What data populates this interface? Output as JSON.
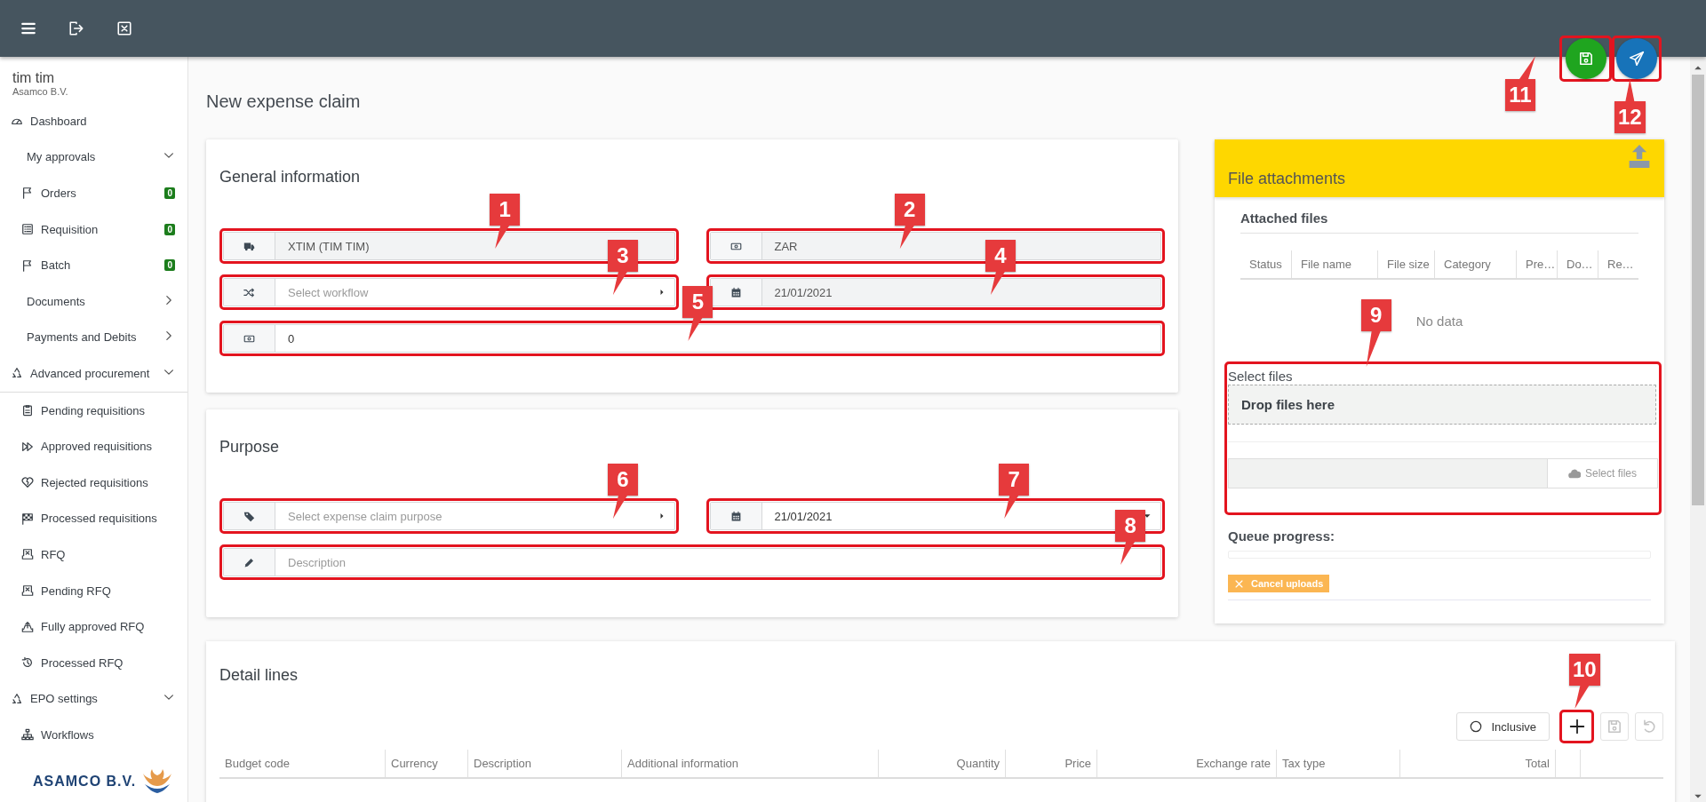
{
  "user": {
    "name": "tim tim",
    "company": "Asamco B.V."
  },
  "sidebar": {
    "items": [
      {
        "label": "Dashboard"
      },
      {
        "label": "My approvals",
        "expanded": true,
        "children": [
          {
            "label": "Orders",
            "badge": "0"
          },
          {
            "label": "Requisition",
            "badge": "0"
          },
          {
            "label": "Batch",
            "badge": "0"
          }
        ]
      },
      {
        "label": "Documents",
        "expanded": false
      },
      {
        "label": "Payments and Debits",
        "expanded": false
      },
      {
        "label": "Advanced procurement",
        "expanded": true,
        "children": [
          {
            "label": "Pending requisitions"
          },
          {
            "label": "Approved requisitions"
          },
          {
            "label": "Rejected requisitions"
          },
          {
            "label": "Processed requisitions"
          },
          {
            "label": "RFQ"
          },
          {
            "label": "Pending RFQ"
          },
          {
            "label": "Fully approved RFQ"
          },
          {
            "label": "Processed RFQ"
          }
        ]
      },
      {
        "label": "EPO settings",
        "expanded": true,
        "children": [
          {
            "label": "Workflows"
          }
        ]
      }
    ],
    "logo": "ASAMCO B.V."
  },
  "page_title": "New expense claim",
  "actions": [
    {
      "kind": "save",
      "callout": "11"
    },
    {
      "kind": "send",
      "callout": "12"
    }
  ],
  "general": {
    "title": "General information",
    "fields": [
      {
        "kind": "text",
        "value": "XTIM (TIM TIM)",
        "disabled": true,
        "callout": "1"
      },
      {
        "kind": "text",
        "value": "ZAR",
        "disabled": true,
        "callout": "2"
      },
      {
        "kind": "select",
        "placeholder": "Select workflow",
        "disabled": false,
        "callout": "3"
      },
      {
        "kind": "date",
        "value": "21/01/2021",
        "disabled": true,
        "callout": "4"
      },
      {
        "kind": "text",
        "value": "0",
        "disabled": false,
        "callout": "5"
      }
    ]
  },
  "purpose": {
    "title": "Purpose",
    "fields": [
      {
        "kind": "select",
        "placeholder": "Select expense claim purpose",
        "disabled": false,
        "callout": "6"
      },
      {
        "kind": "datepicker",
        "value": "21/01/2021",
        "disabled": false,
        "callout": "7"
      },
      {
        "kind": "text",
        "placeholder": "Description",
        "disabled": false,
        "callout": "8"
      }
    ]
  },
  "attachments": {
    "title": "File attachments",
    "subtitle": "Attached files",
    "columns": [
      "Status",
      "File name",
      "File size",
      "Category",
      "Pre…",
      "Do…",
      "Re…"
    ],
    "empty_text": "No data",
    "upload": {
      "callout": "9",
      "label": "Select files",
      "drop_text": "Drop files here",
      "button": "Select files"
    },
    "queue_label": "Queue progress:",
    "progress": {
      "level": 0
    },
    "cancel_button": "Cancel uploads"
  },
  "detail": {
    "title": "Detail lines",
    "toggle": {
      "label": "Inclusive",
      "checked": false
    },
    "tools": [
      {
        "kind": "add",
        "disabled": false,
        "callout": "10"
      },
      {
        "kind": "save",
        "disabled": true
      },
      {
        "kind": "undo",
        "disabled": true
      }
    ],
    "columns": [
      {
        "label": "Budget code",
        "numeric": false
      },
      {
        "label": "Currency",
        "numeric": false
      },
      {
        "label": "Description",
        "numeric": false
      },
      {
        "label": "Additional information",
        "numeric": false
      },
      {
        "label": "Quantity",
        "numeric": true
      },
      {
        "label": "Price",
        "numeric": true
      },
      {
        "label": "Exchange rate",
        "numeric": true
      },
      {
        "label": "Tax type",
        "numeric": false
      },
      {
        "label": "Total",
        "numeric": true
      }
    ]
  }
}
